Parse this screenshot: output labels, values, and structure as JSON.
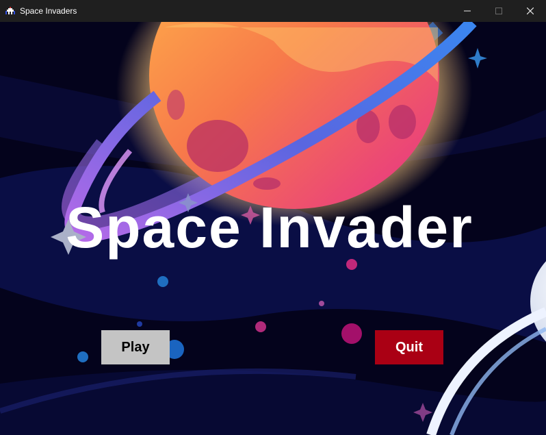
{
  "window": {
    "title": "Space Invaders",
    "controls": {
      "minimize": "—",
      "maximize": "☐",
      "close": "✕"
    }
  },
  "game": {
    "title": "Space Invader",
    "play_label": "Play",
    "quit_label": "Quit"
  },
  "colors": {
    "play_bg": "#c4c4c4",
    "quit_bg": "#aa0014",
    "background": "#05041a"
  }
}
